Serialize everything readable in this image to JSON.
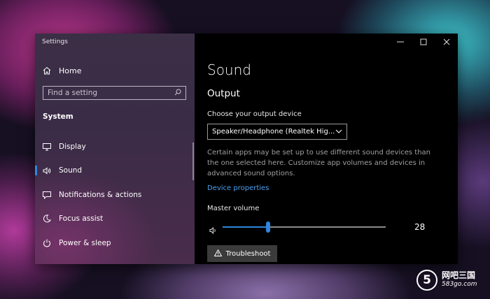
{
  "window": {
    "title": "Settings"
  },
  "sidebar": {
    "home_label": "Home",
    "search_placeholder": "Find a setting",
    "section_title": "System",
    "items": [
      {
        "label": "Display",
        "icon": "monitor-icon"
      },
      {
        "label": "Sound",
        "icon": "speaker-icon",
        "active": true
      },
      {
        "label": "Notifications & actions",
        "icon": "message-icon"
      },
      {
        "label": "Focus assist",
        "icon": "moon-icon"
      },
      {
        "label": "Power & sleep",
        "icon": "power-icon"
      }
    ]
  },
  "content": {
    "page_title": "Sound",
    "output_heading": "Output",
    "device_label": "Choose your output device",
    "device_value": "Speaker/Headphone (Realtek Hig...",
    "description": "Certain apps may be set up to use different sound devices than the one selected here. Customize app volumes and devices in advanced sound options.",
    "device_properties_link": "Device properties",
    "master_volume_label": "Master volume",
    "volume": 28,
    "volume_text": "28",
    "troubleshoot_label": "Troubleshoot"
  },
  "watermark": {
    "badge": "5",
    "line1": "网吧三国",
    "line2": "583go.com"
  },
  "colors": {
    "accent": "#2f86dd",
    "link": "#4ba1f0"
  }
}
